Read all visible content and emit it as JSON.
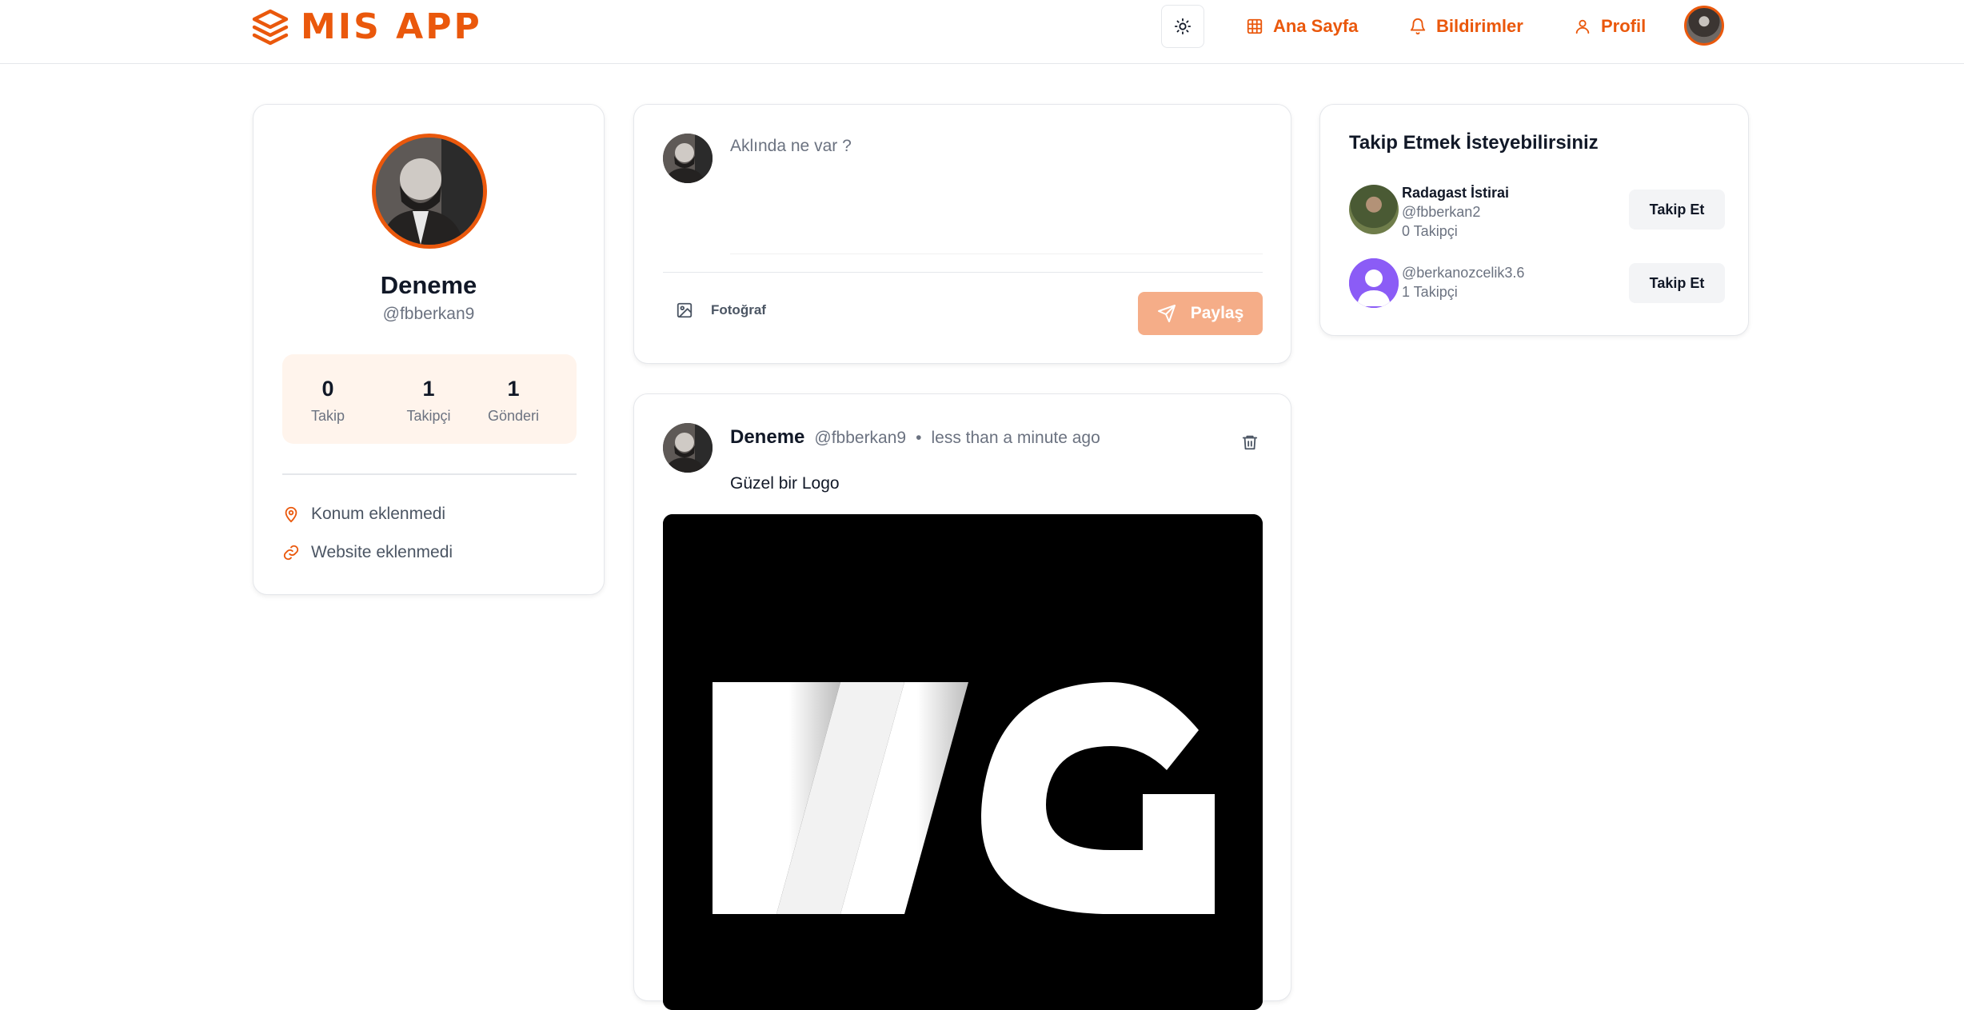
{
  "app": {
    "name": "MIS APP",
    "accent": "#ea580c"
  },
  "nav": {
    "theme_icon": "sun-icon",
    "items": [
      {
        "label": "Ana Sayfa",
        "icon": "grid-icon"
      },
      {
        "label": "Bildirimler",
        "icon": "bell-icon"
      },
      {
        "label": "Profil",
        "icon": "user-icon"
      }
    ]
  },
  "profile": {
    "name": "Deneme",
    "handle": "@fbberkan9",
    "stats": [
      {
        "value": "0",
        "label": "Takip"
      },
      {
        "value": "1",
        "label": "Takipçi"
      },
      {
        "value": "1",
        "label": "Gönderi"
      }
    ],
    "location": "Konum eklenmedi",
    "website": "Website eklenmedi"
  },
  "composer": {
    "placeholder": "Aklında ne var ?",
    "photo_label": "Fotoğraf",
    "share_label": "Paylaş"
  },
  "post": {
    "author": "Deneme",
    "handle": "@fbberkan9",
    "separator": "•",
    "time": "less than a minute ago",
    "text": "Güzel bir Logo",
    "image_text": "MG"
  },
  "suggestions": {
    "title": "Takip Etmek İsteyebilirsiniz",
    "users": [
      {
        "name": "Radagast İstirai",
        "handle": "@fbberkan2",
        "followers": "0 Takipçi",
        "button": "Takip Et"
      },
      {
        "name": "",
        "handle": "@berkanozcelik3.6",
        "followers": "1 Takipçi",
        "button": "Takip Et"
      }
    ]
  }
}
